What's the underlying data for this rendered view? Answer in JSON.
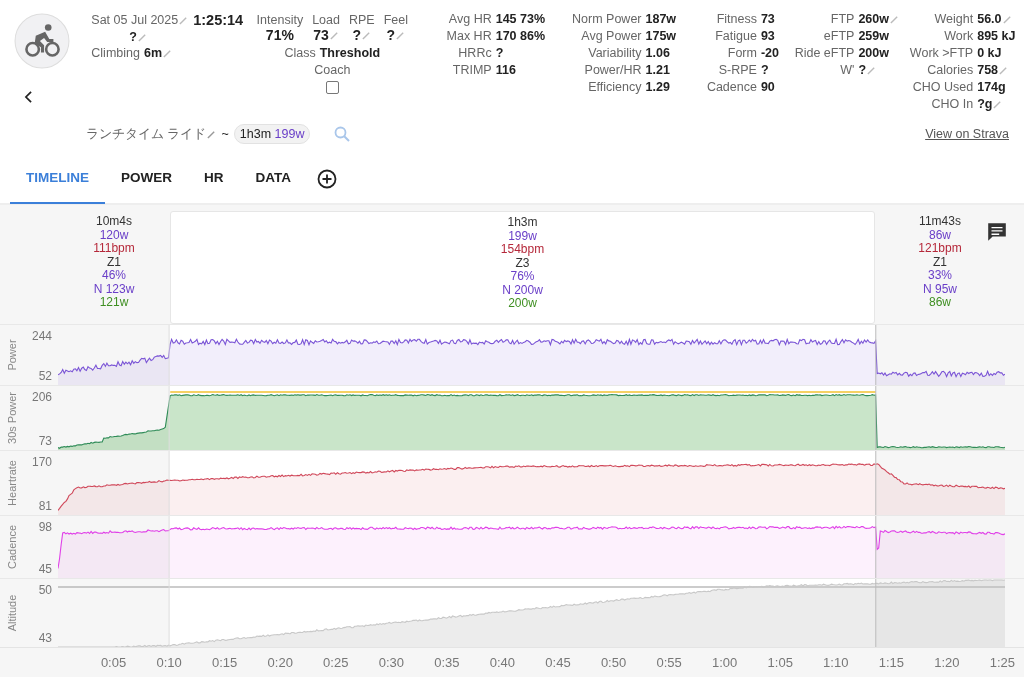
{
  "activity": {
    "date": "Sat 05 Jul 2025",
    "date_editable": true,
    "duration": "1:25:14",
    "name_value": "?",
    "name_editable": true,
    "climbing_label": "Climbing",
    "climbing_value": "6m",
    "climbing_editable": true
  },
  "effort": {
    "top": [
      {
        "label": "Intensity",
        "value": "71%",
        "editable": false
      },
      {
        "label": "Load",
        "value": "73",
        "editable": true
      },
      {
        "label": "RPE",
        "value": "?",
        "editable": true
      },
      {
        "label": "Feel",
        "value": "?",
        "editable": true
      }
    ],
    "class_label": "Class",
    "class_value": "Threshold",
    "coach_label": "Coach",
    "coach_checked": false
  },
  "stat_columns": [
    [
      {
        "label": "Avg HR",
        "value": "145 73%",
        "editable": false
      },
      {
        "label": "Max HR",
        "value": "170 86%",
        "editable": false
      },
      {
        "label": "HRRc",
        "value": "?",
        "editable": false
      },
      {
        "label": "TRIMP",
        "value": "116",
        "editable": false
      }
    ],
    [
      {
        "label": "Norm Power",
        "value": "187w",
        "editable": false
      },
      {
        "label": "Avg Power",
        "value": "175w",
        "editable": false
      },
      {
        "label": "Variability",
        "value": "1.06",
        "editable": false
      },
      {
        "label": "Power/HR",
        "value": "1.21",
        "editable": false
      },
      {
        "label": "Efficiency",
        "value": "1.29",
        "editable": false
      }
    ],
    [
      {
        "label": "Fitness",
        "value": "73",
        "editable": false
      },
      {
        "label": "Fatigue",
        "value": "93",
        "editable": false
      },
      {
        "label": "Form",
        "value": "-20",
        "editable": false
      },
      {
        "label": "S-RPE",
        "value": "?",
        "editable": false
      },
      {
        "label": "Cadence",
        "value": "90",
        "editable": false
      }
    ],
    [
      {
        "label": "FTP",
        "value": "260w",
        "editable": true
      },
      {
        "label": "eFTP",
        "value": "259w",
        "editable": false
      },
      {
        "label": "Ride eFTP",
        "value": "200w",
        "editable": false
      },
      {
        "label": "W'",
        "value": "?",
        "editable": true
      }
    ],
    [
      {
        "label": "Weight",
        "value": "56.0",
        "editable": true
      },
      {
        "label": "Work",
        "value": "895 kJ",
        "editable": false
      },
      {
        "label": "Work >FTP",
        "value": "0 kJ",
        "editable": false
      },
      {
        "label": "Calories",
        "value": "758",
        "editable": true
      },
      {
        "label": "CHO Used",
        "value": "174g",
        "editable": false
      },
      {
        "label": "CHO In",
        "value": "?g",
        "editable": true
      }
    ]
  ],
  "title_line": {
    "name": "ランチタイム ライド",
    "editable": true,
    "separator": "~",
    "chip_time": "1h3m",
    "chip_power": "199w"
  },
  "strava_link": "View on Strava",
  "tabs": [
    {
      "label": "TIMELINE",
      "selected": true
    },
    {
      "label": "POWER",
      "selected": false
    },
    {
      "label": "HR",
      "selected": false
    },
    {
      "label": "DATA",
      "selected": false
    }
  ],
  "intervals": [
    {
      "selected": false,
      "lines": [
        {
          "kind": "time",
          "text": "10m4s"
        },
        {
          "kind": "power",
          "text": "120w"
        },
        {
          "kind": "hr",
          "text": "111bpm"
        },
        {
          "kind": "zone",
          "text": "Z1"
        },
        {
          "kind": "power",
          "text": "46%"
        },
        {
          "kind": "power",
          "text": "N 123w"
        },
        {
          "kind": "avg",
          "text": "121w"
        }
      ]
    },
    {
      "selected": true,
      "lines": [
        {
          "kind": "time",
          "text": "1h3m"
        },
        {
          "kind": "power",
          "text": "199w"
        },
        {
          "kind": "hr",
          "text": "154bpm"
        },
        {
          "kind": "zone",
          "text": "Z3"
        },
        {
          "kind": "power",
          "text": "76%"
        },
        {
          "kind": "power",
          "text": "N 200w"
        },
        {
          "kind": "avg",
          "text": "200w"
        }
      ]
    },
    {
      "selected": false,
      "lines": [
        {
          "kind": "time",
          "text": "11m43s"
        },
        {
          "kind": "power",
          "text": "86w"
        },
        {
          "kind": "hr",
          "text": "121bpm"
        },
        {
          "kind": "zone",
          "text": "Z1"
        },
        {
          "kind": "power",
          "text": "33%"
        },
        {
          "kind": "power",
          "text": "N 95w"
        },
        {
          "kind": "avg",
          "text": "86w"
        }
      ]
    }
  ],
  "panels": [
    {
      "kind": "power",
      "label": "Power",
      "ymax": "244",
      "ymin": "52"
    },
    {
      "kind": "power30",
      "label": "30s Power",
      "ymax": "206",
      "ymin": "73"
    },
    {
      "kind": "hr",
      "label": "Heartrate",
      "ymax": "170",
      "ymin": "81"
    },
    {
      "kind": "cadence",
      "label": "Cadence",
      "ymax": "98",
      "ymin": "45"
    },
    {
      "kind": "altitude",
      "label": "Altitude",
      "ymax": "50",
      "ymin": "43"
    }
  ],
  "x_ticks": [
    "0:05",
    "0:10",
    "0:15",
    "0:20",
    "0:25",
    "0:30",
    "0:35",
    "0:40",
    "0:45",
    "0:50",
    "0:55",
    "1:00",
    "1:05",
    "1:10",
    "1:15",
    "1:20",
    "1:25"
  ]
}
